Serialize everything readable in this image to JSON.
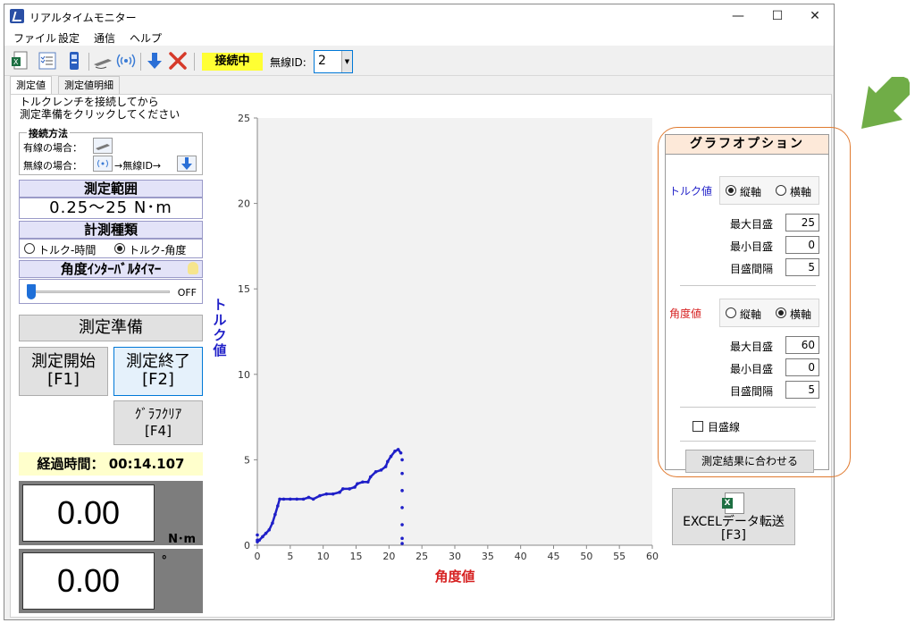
{
  "window": {
    "title": "リアルタイムモニター",
    "minimize": "—",
    "maximize": "☐",
    "close": "✕"
  },
  "menu": [
    "ファイル",
    "設定",
    "通信",
    "ヘルプ"
  ],
  "toolbar": {
    "status": "接続中",
    "wireless_id_label": "無線ID:",
    "wireless_id_value": "2"
  },
  "tabs": [
    "測定値",
    "測定値明細"
  ],
  "left": {
    "instruction_1": "トルクレンチを接続してから",
    "instruction_2": "測定準備をクリックしてください",
    "connection": {
      "legend": "接続方法",
      "wired_label": "有線の場合：",
      "wireless_label": "無線の場合：",
      "wireless_arrow": "→無線ID→"
    },
    "range_header": "測定範囲",
    "range_value": "0.25〜25 N･m",
    "type_header": "計測種類",
    "type_torque_time": "トルク-時間",
    "type_torque_angle": "トルク-角度",
    "type_selected": "torque_angle",
    "timer_header": "角度ｲﾝﾀｰﾊﾞﾙﾀｲﾏｰ",
    "timer_value": "OFF",
    "prepare_btn": "測定準備",
    "start_btn_1": "測定開始",
    "start_btn_2": "[F1]",
    "stop_btn_1": "測定終了",
    "stop_btn_2": "[F2]",
    "clear_btn_1": "ｸﾞﾗﾌｸﾘｱ",
    "clear_btn_2": "[F4]",
    "elapsed_label": "経過時間：",
    "elapsed_value": "00:14.107",
    "torque_value": "0.00",
    "torque_unit": "N･m",
    "angle_value": "0.00",
    "angle_unit": "°"
  },
  "chart_data": {
    "type": "scatter",
    "xlabel": "角度値",
    "ylabel": "トルク値",
    "xlim": [
      0,
      60
    ],
    "ylim": [
      0,
      25
    ],
    "x_ticks": [
      0,
      5,
      10,
      15,
      20,
      25,
      30,
      35,
      40,
      45,
      50,
      55,
      60
    ],
    "y_ticks": [
      0,
      5,
      10,
      15,
      20,
      25
    ],
    "grid": false,
    "color": "#1f1fc8",
    "series": [
      {
        "points": [
          [
            0,
            0.2
          ],
          [
            0.3,
            0.3
          ],
          [
            0.8,
            0.5
          ],
          [
            1.3,
            0.7
          ],
          [
            1.8,
            0.9
          ],
          [
            2.3,
            1.3
          ],
          [
            2.7,
            1.8
          ],
          [
            3.1,
            2.3
          ],
          [
            3.4,
            2.7
          ],
          [
            4,
            2.7
          ],
          [
            5,
            2.7
          ],
          [
            6,
            2.7
          ],
          [
            7,
            2.7
          ],
          [
            7.8,
            2.8
          ],
          [
            8.5,
            2.7
          ],
          [
            9.5,
            2.9
          ],
          [
            10.5,
            3.0
          ],
          [
            11.5,
            3.0
          ],
          [
            12.5,
            3.1
          ],
          [
            13,
            3.3
          ],
          [
            14,
            3.3
          ],
          [
            14.8,
            3.4
          ],
          [
            15.2,
            3.6
          ],
          [
            16,
            3.7
          ],
          [
            16.8,
            3.7
          ],
          [
            17.2,
            4.0
          ],
          [
            18,
            4.3
          ],
          [
            18.8,
            4.4
          ],
          [
            19.5,
            4.6
          ],
          [
            19.8,
            4.9
          ],
          [
            20.3,
            5.2
          ],
          [
            20.9,
            5.5
          ],
          [
            21.4,
            5.6
          ],
          [
            21.8,
            5.4
          ],
          [
            22,
            5.0
          ],
          [
            22,
            4.2
          ],
          [
            22,
            3.2
          ],
          [
            22,
            2.2
          ],
          [
            22,
            1.2
          ],
          [
            22,
            0.4
          ],
          [
            22,
            0.1
          ],
          [
            0,
            0.6
          ],
          [
            0,
            0.3
          ]
        ]
      }
    ]
  },
  "options": {
    "title": "グラフオプション",
    "torque_label": "トルク値",
    "angle_label": "角度値",
    "vertical": "縦軸",
    "horizontal": "横軸",
    "torque_axis": "vertical",
    "angle_axis": "horizontal",
    "max_label": "最大目盛",
    "min_label": "最小目盛",
    "step_label": "目盛間隔",
    "torque_max": "25",
    "torque_min": "0",
    "torque_step": "5",
    "angle_max": "60",
    "angle_min": "0",
    "angle_step": "5",
    "gridlines_label": "目盛線",
    "gridlines_on": false,
    "fit_btn": "測定結果に合わせる"
  },
  "excel": {
    "line_1": "EXCELデータ転送",
    "line_2": "[F3]"
  },
  "colors": {
    "torque_label": "#1f1fc8",
    "angle_label": "#d62020",
    "hint_arrow": "#70ad47",
    "frame": "#e07a2f"
  }
}
